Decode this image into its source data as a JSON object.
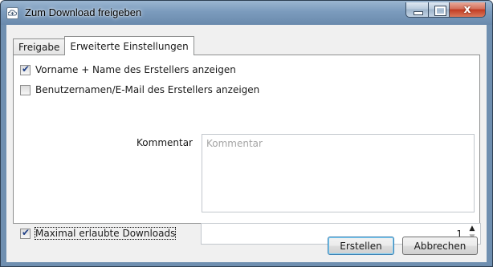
{
  "window": {
    "title": "Zum Download freigeben",
    "icon": "cloud-share-icon",
    "close_symbol": "x"
  },
  "tabs": [
    {
      "label": "Freigabe",
      "active": false
    },
    {
      "label": "Erweiterte Einstellungen",
      "active": true
    }
  ],
  "options": {
    "show_name": {
      "label": "Vorname + Name des Erstellers anzeigen",
      "checked": true
    },
    "show_username": {
      "label": "Benutzernamen/E-Mail des Erstellers anzeigen",
      "checked": false
    },
    "max_downloads": {
      "label": "Maximal erlaubte Downloads",
      "checked": true,
      "value": "1"
    }
  },
  "comment": {
    "label": "Kommentar",
    "placeholder": "Kommentar",
    "value": ""
  },
  "buttons": {
    "create": "Erstellen",
    "cancel": "Abbrechen"
  },
  "colors": {
    "title_bar": "#7b9bbd",
    "close_button": "#c13b22",
    "check_mark": "#1f3f86",
    "default_button_border": "#3c7fb1"
  }
}
